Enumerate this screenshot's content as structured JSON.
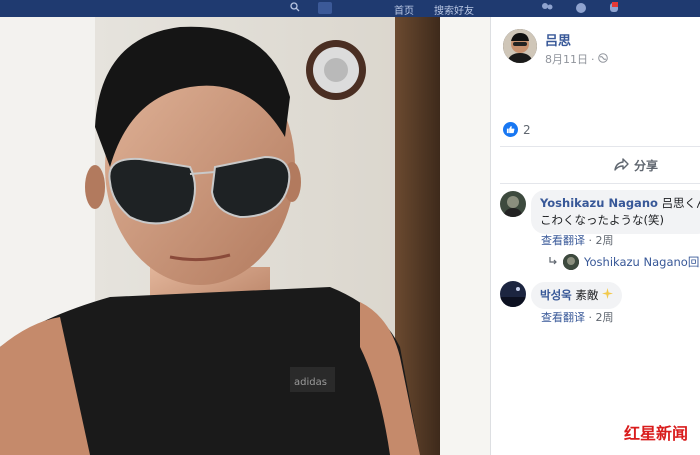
{
  "topbar": {
    "nav_items": [
      "",
      "首页",
      "搜索好友",
      "",
      ""
    ]
  },
  "post": {
    "author": "吕思",
    "date": "8月11日",
    "privacy_icon": "globe-icon",
    "reaction_icon": "thumbs-up-icon",
    "likes": "2",
    "share_label": "分享"
  },
  "comments": [
    {
      "author": "Yoshikazu Nagano",
      "text_line1": "吕思くん、",
      "text_line2": "こわくなったような(笑)",
      "translate_label": "查看翻译",
      "time": "2周"
    },
    {
      "author": "박성욱",
      "text": "素敵",
      "emoji_icon": "sparkle-icon",
      "translate_label": "查看翻译",
      "time": "2周"
    }
  ],
  "reply": {
    "author": "Yoshikazu Nagano",
    "suffix": "回复"
  },
  "watermark": {
    "text": "红星新闻"
  },
  "colors": {
    "fb_blue": "#385898",
    "like_blue": "#1877f2",
    "topbar": "#1f3a70",
    "watermark": "#d91c1c"
  }
}
